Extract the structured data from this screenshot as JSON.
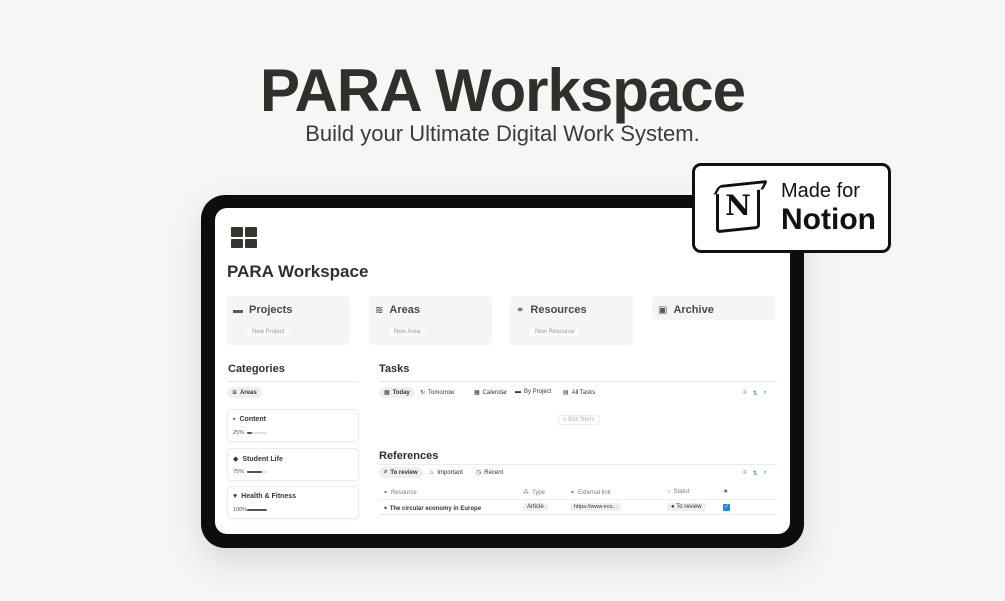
{
  "hero": {
    "title": "PARA Workspace",
    "subtitle": "Build your Ultimate Digital Work System."
  },
  "badge": {
    "made_for": "Made for",
    "brand": "Notion",
    "logo_letter": "N"
  },
  "page": {
    "icon": "grid-icon",
    "title": "PARA Workspace"
  },
  "cards": [
    {
      "icon": "folder-icon",
      "label": "Projects",
      "button": "New Project"
    },
    {
      "icon": "stack-icon",
      "label": "Areas",
      "button": "New Area"
    },
    {
      "icon": "link-icon",
      "label": "Resources",
      "button": "New Resource"
    },
    {
      "icon": "archive-icon",
      "label": "Archive"
    }
  ],
  "categories": {
    "title": "Categories",
    "filter_chip": "Areas",
    "areas": [
      {
        "icon": "box-icon",
        "name": "Content",
        "percent": "25%",
        "progress": 0.25
      },
      {
        "icon": "cap-icon",
        "name": "Student Life",
        "percent": "75%",
        "progress": 0.75
      },
      {
        "icon": "heart-icon",
        "name": "Health & Fitness",
        "percent": "100%",
        "progress": 1.0
      }
    ]
  },
  "tasks": {
    "title": "Tasks",
    "views": [
      {
        "icon": "calendar-icon",
        "label": "Today",
        "active": true
      },
      {
        "icon": "arrow-icon",
        "label": "Tomorrow"
      },
      {
        "icon": "calendar-icon",
        "label": "Calendar"
      },
      {
        "icon": "folder-icon",
        "label": "By Project"
      },
      {
        "icon": "table-icon",
        "label": "All Tasks"
      }
    ],
    "edit_filters": "Edit filters"
  },
  "references": {
    "title": "References",
    "views": [
      {
        "icon": "search-icon",
        "label": "To review",
        "active": true
      },
      {
        "icon": "fire-icon",
        "label": "Important"
      },
      {
        "icon": "clock-icon",
        "label": "Recent"
      }
    ],
    "columns": [
      "Resource",
      "Type",
      "External link",
      "Statut",
      "★"
    ],
    "rows": [
      {
        "resource": "The circular economy in Europe",
        "type": "Article",
        "link": "https://www.eco...",
        "status": "To review",
        "starred": true
      }
    ]
  },
  "colors": {
    "accent": "#2383e2",
    "text": "#37352f",
    "card_bg": "#f5f5f4"
  }
}
